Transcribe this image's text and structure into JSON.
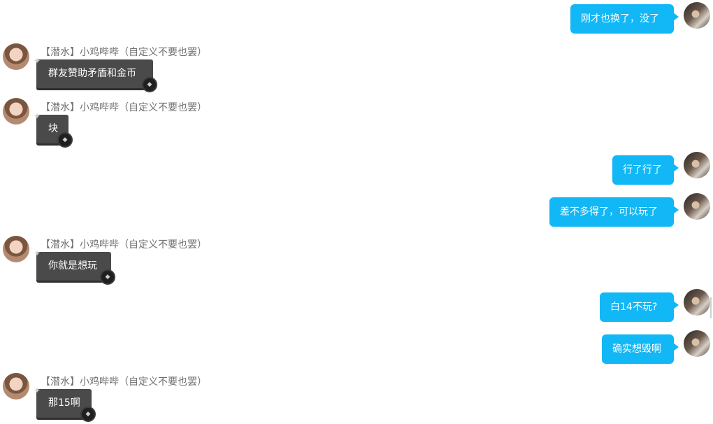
{
  "messages": [
    {
      "side": "out",
      "text": "刚才也换了，没了"
    },
    {
      "side": "in",
      "name": "【潜水】小鸡哔哔（自定义不要也罢）",
      "text": "群友赞助矛盾和金币"
    },
    {
      "side": "in",
      "name": "【潜水】小鸡哔哔（自定义不要也罢）",
      "text": "块"
    },
    {
      "side": "out",
      "text": "行了行了"
    },
    {
      "side": "out",
      "text": "差不多得了，可以玩了"
    },
    {
      "side": "in",
      "name": "【潜水】小鸡哔哔（自定义不要也罢）",
      "text": "你就是想玩"
    },
    {
      "side": "out",
      "text": "白14不玩?"
    },
    {
      "side": "out",
      "text": "确实想毁啊"
    },
    {
      "side": "in",
      "name": "【潜水】小鸡哔哔（自定义不要也罢）",
      "text": "那15啊"
    }
  ],
  "colors": {
    "outgoing_bubble": "#12b7f5",
    "incoming_bubble": "#4a4a4a",
    "name_text": "#6f6f6f"
  },
  "icons": {
    "bubble_corner": "sparkle-icon",
    "bubble_badge": "cat-badge-icon"
  }
}
